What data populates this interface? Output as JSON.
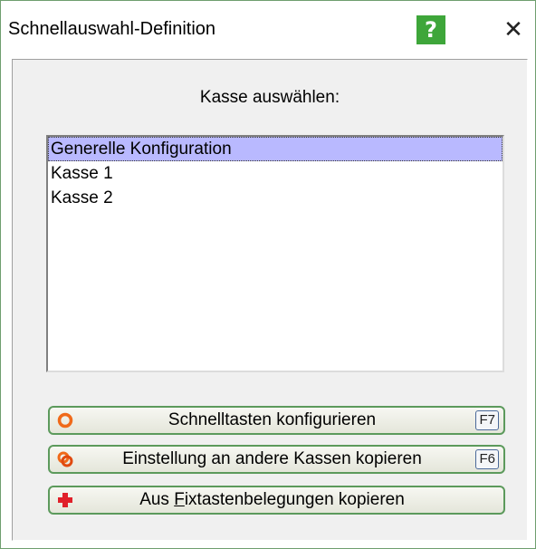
{
  "window": {
    "title": "Schnellauswahl-Definition",
    "help_label": "?",
    "close_label": "✕"
  },
  "main": {
    "prompt": "Kasse auswählen:",
    "list": {
      "items": [
        {
          "label": "Generelle Konfiguration",
          "selected": true
        },
        {
          "label": "Kasse 1",
          "selected": false
        },
        {
          "label": "Kasse 2",
          "selected": false
        }
      ]
    },
    "buttons": [
      {
        "label": "Schnelltasten konfigurieren",
        "shortcut": "F7",
        "icon": "ring-icon"
      },
      {
        "label": "Einstellung an andere Kassen kopieren",
        "shortcut": "F6",
        "icon": "double-ring-icon"
      },
      {
        "label_prefix": "Aus ",
        "label_accel": "F",
        "label_rest": "ixtastenbelegungen kopieren",
        "icon": "red-cross-icon"
      }
    ]
  },
  "colors": {
    "selection": "#b9b9ff",
    "button_border": "#5c9a5c",
    "help_bg": "#3ea63a",
    "icon_orange": "#f06a1a",
    "icon_red": "#e0202a"
  }
}
